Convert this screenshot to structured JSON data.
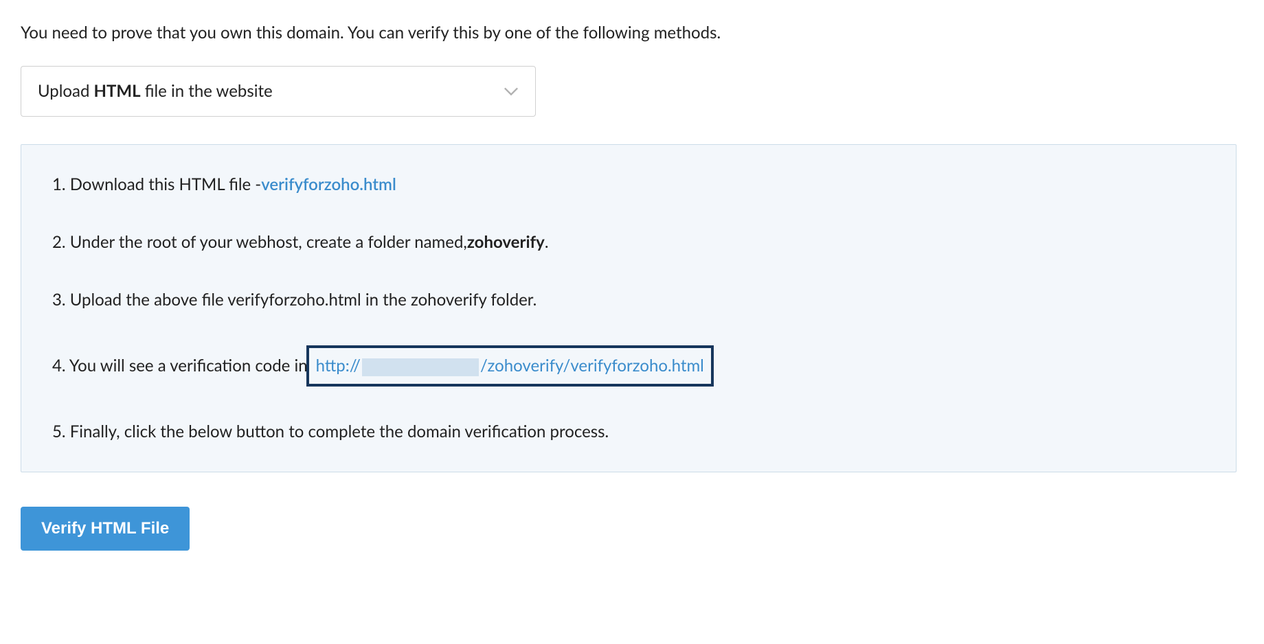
{
  "intro": "You need to prove that you own this domain. You can verify this by one of the following methods.",
  "dropdown": {
    "prefix": "Upload ",
    "bold": "HTML",
    "suffix": " file in the website"
  },
  "instructions": {
    "step1_prefix": "1. Download this HTML file - ",
    "step1_link": "verifyforzoho.html",
    "step2_prefix": "2. Under the root of your webhost, create a folder named, ",
    "step2_bold": "zohoverify",
    "step2_suffix": ".",
    "step3": "3. Upload the above file verifyforzoho.html in the zohoverify folder.",
    "step4_prefix": "4. You will see a verification code in ",
    "step4_url_protocol": "http://",
    "step4_url_path": "/zohoverify/verifyforzoho.html",
    "step5": "5. Finally, click the below button to complete the domain verification process."
  },
  "button": {
    "label": "Verify HTML File"
  }
}
